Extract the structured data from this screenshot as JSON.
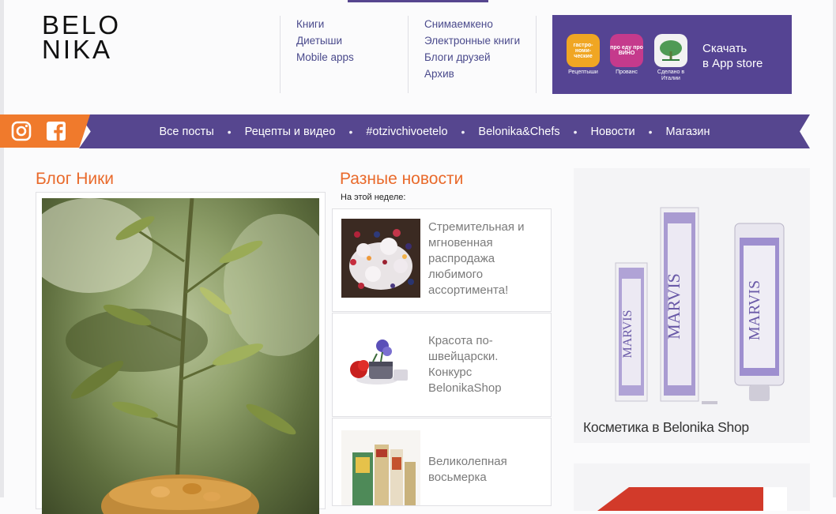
{
  "logo": {
    "line1": "BELO",
    "line2": "NIKA"
  },
  "header_nav": {
    "col1": [
      "Книги",
      "Диетыши",
      "Mobile apps"
    ],
    "col2": [
      "Снимаемкено",
      "Электронные книги",
      "Блоги друзей",
      "Архив"
    ]
  },
  "app_banner": {
    "apps": [
      {
        "title": "гастро-номи-ческие",
        "caption": "Рецептыши"
      },
      {
        "title": "про еду про ВИНО",
        "caption": "Прованс"
      },
      {
        "title": "",
        "caption": "Сделано в Италии"
      }
    ],
    "cta_line1": "Скачать",
    "cta_line2": "в App store"
  },
  "social": {
    "instagram": "instagram-icon",
    "facebook": "facebook-icon"
  },
  "main_nav": [
    "Все посты",
    "Рецепты и видео",
    "#otzivchivoetelo",
    "Belonika&Chefs",
    "Новости",
    "Магазин"
  ],
  "blog": {
    "title": "Блог Ники"
  },
  "news": {
    "title": "Разные новости",
    "week_label": "На этой неделе:",
    "items": [
      {
        "text": "Стремительная и мгновенная распродажа любимого ассортимента!"
      },
      {
        "text": "Красота по-швейцарски. Конкурс BelonikaShop"
      },
      {
        "text": "Великолепная восьмерка"
      }
    ]
  },
  "shop": {
    "caption": "Косметика в Belonika Shop",
    "brand": "MARVIS"
  },
  "colors": {
    "accent_purple": "#56468f",
    "accent_orange": "#f07a2c",
    "title_orange": "#e96a2b"
  }
}
